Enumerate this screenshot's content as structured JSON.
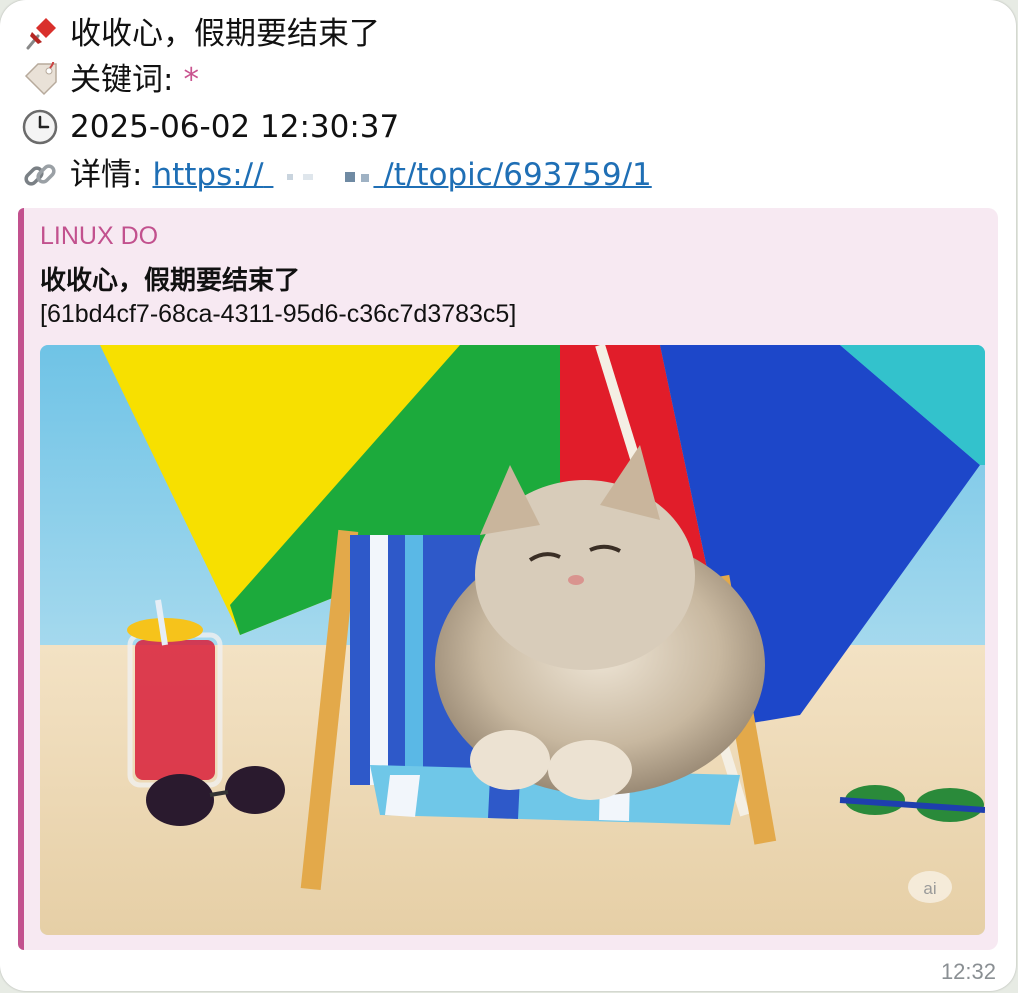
{
  "message": {
    "title_line": "收收心，假期要结束了",
    "keywords_label": "关键词:",
    "keywords_value": "*",
    "datetime": "2025-06-02 12:30:37",
    "details_label": "详情:",
    "link_prefix": "https://",
    "link_suffix": "/t/topic/693759/1",
    "icons": [
      "pushpin-icon",
      "tag-icon",
      "clock-icon",
      "link-icon"
    ],
    "time": "12:32"
  },
  "preview": {
    "site_name": "LINUX DO",
    "title": "收收心，假期要结束了",
    "id": "[61bd4cf7-68ca-4311-95d6-c36c7d3783c5]",
    "image_badge": "ai",
    "accent_color": "#c2518e",
    "background_color": "#f7e9f2"
  }
}
